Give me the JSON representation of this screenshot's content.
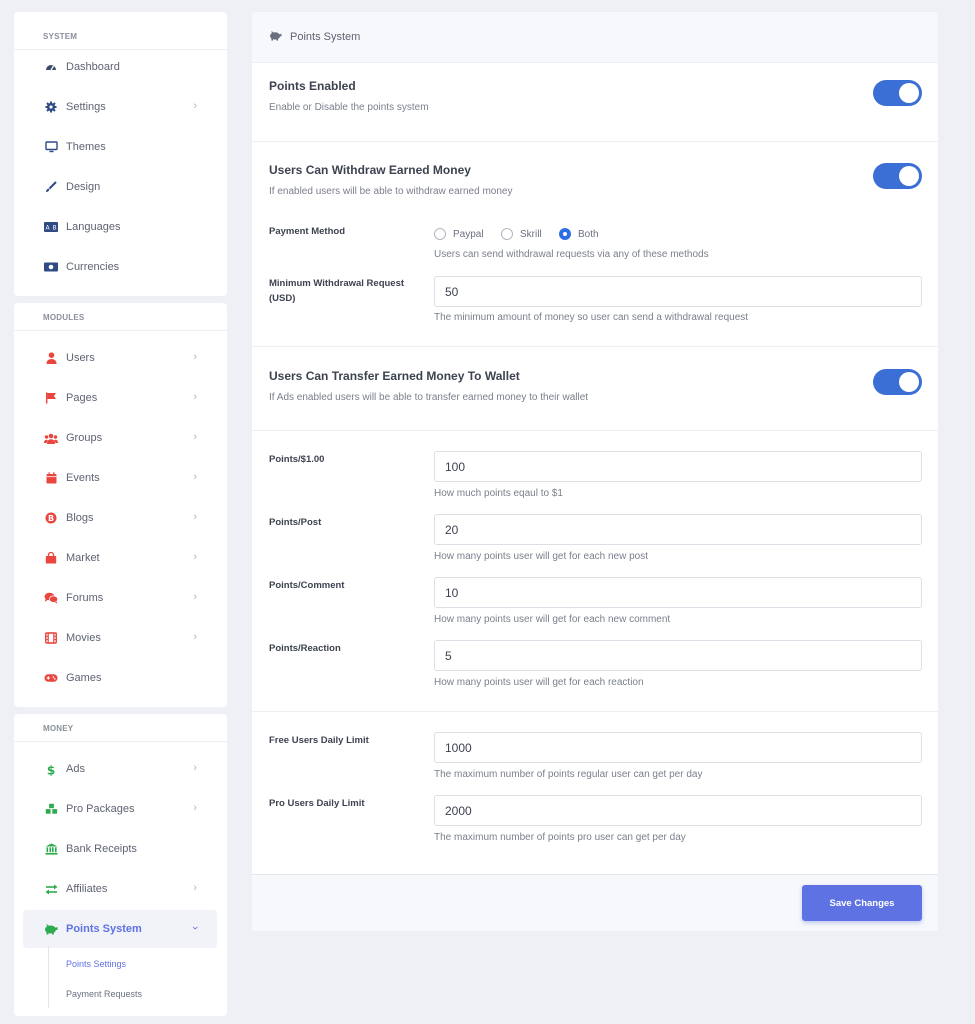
{
  "sidebar": {
    "system": {
      "heading": "System",
      "items": [
        {
          "label": "Dashboard",
          "icon": "dashboard-icon",
          "color": "#3a4a6b"
        },
        {
          "label": "Settings",
          "icon": "gear-icon",
          "color": "#2f4a85"
        },
        {
          "label": "Themes",
          "icon": "desktop-icon",
          "color": "#2f4a85"
        },
        {
          "label": "Design",
          "icon": "paint-brush-icon",
          "color": "#2f4a85"
        },
        {
          "label": "Languages",
          "icon": "language-icon",
          "color": "#2f4a85"
        },
        {
          "label": "Currencies",
          "icon": "money-bill-icon",
          "color": "#2f4a85"
        }
      ]
    },
    "modules": {
      "heading": "Modules",
      "items": [
        {
          "label": "Users",
          "icon": "user-icon",
          "color": "#e8463e"
        },
        {
          "label": "Pages",
          "icon": "flag-icon",
          "color": "#e8463e"
        },
        {
          "label": "Groups",
          "icon": "users-icon",
          "color": "#e8463e"
        },
        {
          "label": "Events",
          "icon": "calendar-icon",
          "color": "#e8463e"
        },
        {
          "label": "Blogs",
          "icon": "blog-icon",
          "color": "#e8463e"
        },
        {
          "label": "Market",
          "icon": "shopping-bag-icon",
          "color": "#e8463e"
        },
        {
          "label": "Forums",
          "icon": "comments-icon",
          "color": "#e8463e"
        },
        {
          "label": "Movies",
          "icon": "film-icon",
          "color": "#e8463e"
        },
        {
          "label": "Games",
          "icon": "gamepad-icon",
          "color": "#e8463e"
        }
      ]
    },
    "money": {
      "heading": "Money",
      "items": [
        {
          "label": "Ads",
          "icon": "dollar-icon",
          "color": "#2dab4f"
        },
        {
          "label": "Pro Packages",
          "icon": "cubes-icon",
          "color": "#2dab4f"
        },
        {
          "label": "Bank Receipts",
          "icon": "bank-icon",
          "color": "#2dab4f"
        },
        {
          "label": "Affiliates",
          "icon": "exchange-icon",
          "color": "#2dab4f"
        },
        {
          "label": "Points System",
          "icon": "piggy-bank-icon",
          "color": "#2dab4f"
        }
      ],
      "sub_items": [
        "Points Settings",
        "Payment Requests"
      ]
    }
  },
  "panel": {
    "title": "Points System",
    "points_enabled": {
      "title": "Points Enabled",
      "desc": "Enable or Disable the points system",
      "on": true
    },
    "withdraw": {
      "title": "Users Can Withdraw Earned Money",
      "desc": "If enabled users will be able to withdraw earned money",
      "on": true
    },
    "payment_method": {
      "label": "Payment Method",
      "options": [
        "Paypal",
        "Skrill",
        "Both"
      ],
      "selected": "Both",
      "help": "Users can send withdrawal requests via any of these methods"
    },
    "min_withdrawal": {
      "label": "Minimum Withdrawal Request (USD)",
      "value": "50",
      "help": "The minimum amount of money so user can send a withdrawal request"
    },
    "transfer": {
      "title": "Users Can Transfer Earned Money To Wallet",
      "desc": "If Ads enabled users will be able to transfer earned money to their wallet",
      "on": true
    },
    "points_per_dollar": {
      "label": "Points/$1.00",
      "value": "100",
      "help": "How much points eqaul to $1"
    },
    "points_per_post": {
      "label": "Points/Post",
      "value": "20",
      "help": "How many points user will get for each new post"
    },
    "points_per_comment": {
      "label": "Points/Comment",
      "value": "10",
      "help": "How many points user will get for each new comment"
    },
    "points_per_reaction": {
      "label": "Points/Reaction",
      "value": "5",
      "help": "How many points user will get for each reaction"
    },
    "free_limit": {
      "label": "Free Users Daily Limit",
      "value": "1000",
      "help": "The maximum number of points regular user can get per day"
    },
    "pro_limit": {
      "label": "Pro Users Daily Limit",
      "value": "2000",
      "help": "The maximum number of points pro user can get per day"
    },
    "save_label": "Save Changes"
  },
  "colors": {
    "accent": "#5e72e4",
    "toggle": "#3b6fd6",
    "radio": "#2f6fe4"
  }
}
